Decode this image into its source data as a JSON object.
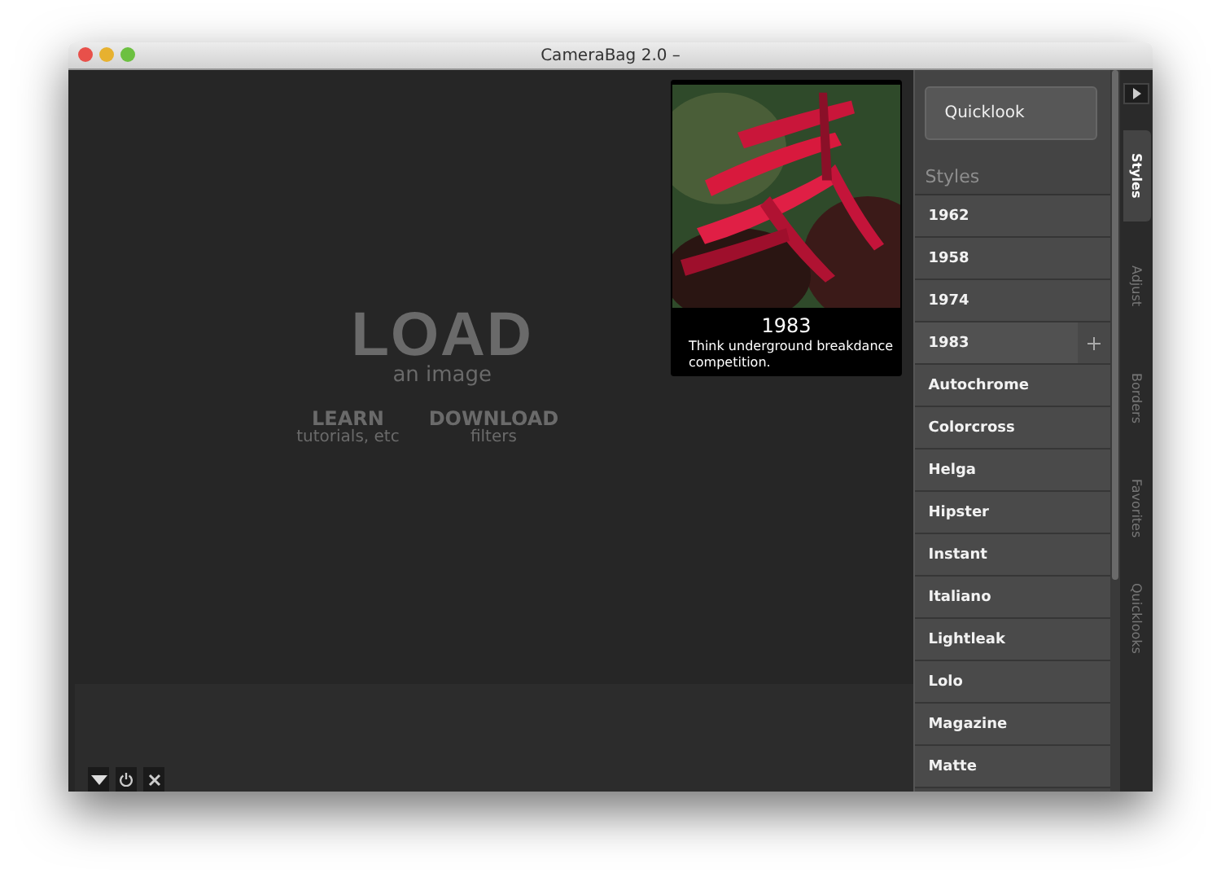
{
  "window": {
    "title": "CameraBag 2.0 –"
  },
  "canvas": {
    "load_title": "LOAD",
    "load_subtitle": "an image",
    "links": [
      {
        "title": "LEARN",
        "subtitle": "tutorials, etc"
      },
      {
        "title": "DOWNLOAD",
        "subtitle": "filters"
      }
    ]
  },
  "preview": {
    "kind": "picture",
    "title": "1983",
    "description": "Think underground breakdance competition."
  },
  "sidebar": {
    "quicklook_button": "Quicklook",
    "section_title": "Styles",
    "styles": [
      {
        "label": "1962",
        "hovered": false
      },
      {
        "label": "1958",
        "hovered": false
      },
      {
        "label": "1974",
        "hovered": false
      },
      {
        "label": "1983",
        "hovered": true
      },
      {
        "label": "Autochrome",
        "hovered": false
      },
      {
        "label": "Colorcross",
        "hovered": false
      },
      {
        "label": "Helga",
        "hovered": false
      },
      {
        "label": "Hipster",
        "hovered": false
      },
      {
        "label": "Instant",
        "hovered": false
      },
      {
        "label": "Italiano",
        "hovered": false
      },
      {
        "label": "Lightleak",
        "hovered": false
      },
      {
        "label": "Lolo",
        "hovered": false
      },
      {
        "label": "Magazine",
        "hovered": false
      },
      {
        "label": "Matte",
        "hovered": false
      }
    ]
  },
  "tabs": [
    {
      "label": "Styles",
      "selected": true
    },
    {
      "label": "Adjust",
      "selected": false
    },
    {
      "label": "Borders",
      "selected": false
    },
    {
      "label": "Favorites",
      "selected": false
    },
    {
      "label": "Quicklooks",
      "selected": false
    }
  ]
}
